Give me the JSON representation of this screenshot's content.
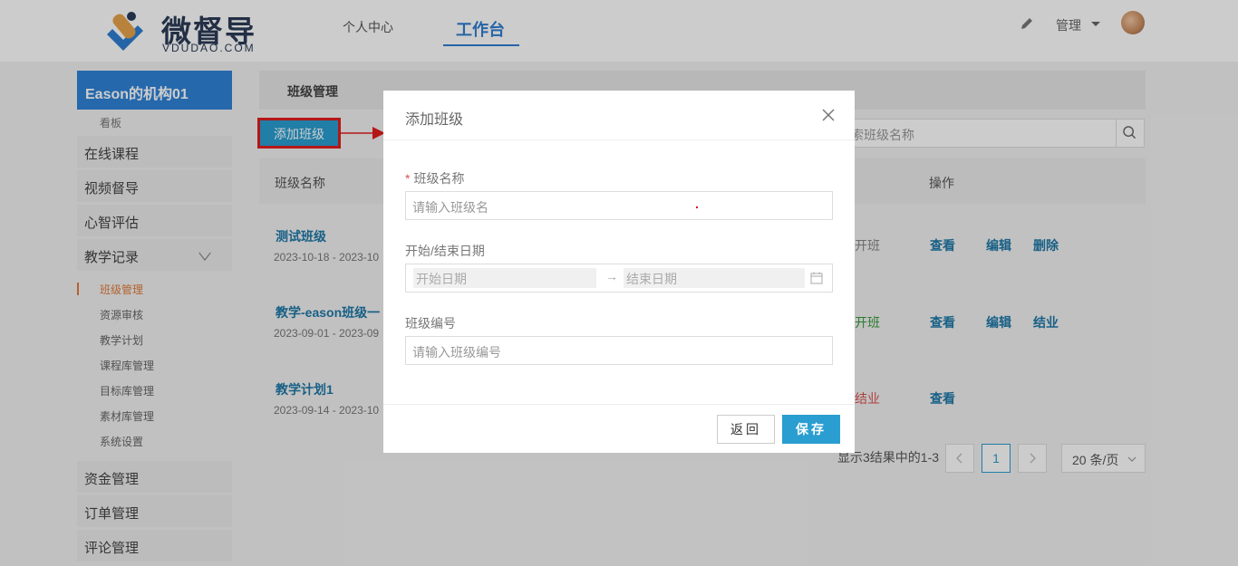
{
  "brand": {
    "name": "微督导",
    "domain": "VDUDAO.COM"
  },
  "nav": {
    "items": [
      "个人中心",
      "工作台"
    ],
    "active_index": 1
  },
  "user": {
    "menu_label": "管理"
  },
  "sidebar": {
    "org_title": "Eason的机构01",
    "kanban": "看板",
    "items": [
      "在线课程",
      "视频督导",
      "心智评估",
      "教学记录"
    ],
    "sub_items": [
      "班级管理",
      "资源审核",
      "教学计划",
      "课程库管理",
      "目标库管理",
      "素材库管理",
      "系统设置"
    ],
    "active_sub": "班级管理",
    "bottom_items": [
      "资金管理",
      "订单管理",
      "评论管理"
    ]
  },
  "main": {
    "panel_title": "班级管理",
    "add_button": "添加班级",
    "search_placeholder": "索班级名称",
    "columns": {
      "name": "班级名称",
      "actions": "操作"
    },
    "rows": [
      {
        "name": "测试班级",
        "date": "2023-10-18 - 2023-10",
        "status": "开班",
        "status_color": "#888888",
        "actions": [
          "查看",
          "编辑",
          "删除"
        ]
      },
      {
        "name": "教学-eason班级一",
        "date": "2023-09-01 - 2023-09",
        "status": "开班",
        "status_color": "#3a9a3a",
        "actions": [
          "查看",
          "编辑",
          "结业"
        ]
      },
      {
        "name": "教学计划1",
        "date": "2023-09-14 - 2023-10",
        "status": "结业",
        "status_color": "#d9534f",
        "actions": [
          "查看"
        ]
      }
    ],
    "pager": {
      "summary": "显示3结果中的1-3",
      "current_page": "1",
      "page_size": "20 条/页"
    }
  },
  "modal": {
    "title": "添加班级",
    "fields": {
      "class_name": {
        "label": "班级名称",
        "required_mark": "*",
        "placeholder": "请输入班级名"
      },
      "dates": {
        "label": "开始/结束日期",
        "start_placeholder": "开始日期",
        "end_placeholder": "结束日期",
        "separator": "→"
      },
      "class_code": {
        "label": "班级编号",
        "placeholder": "请输入班级编号"
      }
    },
    "back_button": "返回",
    "save_button": "保存"
  },
  "colors": {
    "primary": "#2a9ed1",
    "nav_active": "#2f7fd1",
    "highlight_box": "#e21d1d"
  }
}
